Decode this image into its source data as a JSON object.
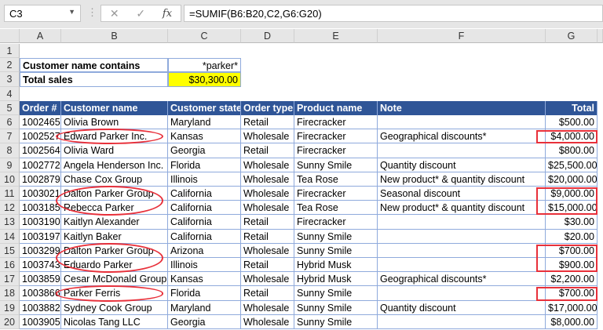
{
  "formula_bar": {
    "name_box": "C3",
    "formula": "=SUMIF(B6:B20,C2,G6:G20)",
    "cancel_icon": "✕",
    "enter_icon": "✓",
    "fx_icon": "fx"
  },
  "columns": [
    "A",
    "B",
    "C",
    "D",
    "E",
    "F",
    "G"
  ],
  "criteria": {
    "label": "Customer name contains",
    "value": "*parker*",
    "total_label": "Total sales",
    "total_value": "$30,300.00"
  },
  "table": {
    "headers": [
      "Order #",
      "Customer name",
      "Customer state",
      "Order type",
      "Product name",
      "Note",
      "Total"
    ],
    "rows": [
      [
        "1002465",
        "Olivia Brown",
        "Maryland",
        "Retail",
        "Firecracker",
        "",
        "$500.00"
      ],
      [
        "1002527",
        "Edward Parker Inc.",
        "Kansas",
        "Wholesale",
        "Firecracker",
        "Geographical discounts*",
        "$4,000.00"
      ],
      [
        "1002564",
        "Olivia Ward",
        "Georgia",
        "Retail",
        "Firecracker",
        "",
        "$800.00"
      ],
      [
        "1002772",
        "Angela Henderson Inc.",
        "Florida",
        "Wholesale",
        "Sunny Smile",
        "Quantity discount",
        "$25,500.00"
      ],
      [
        "1002879",
        "Chase Cox Group",
        "Illinois",
        "Wholesale",
        "Tea Rose",
        "New product* & quantity discount",
        "$20,000.00"
      ],
      [
        "1003021",
        "Dalton Parker Group",
        "California",
        "Wholesale",
        "Firecracker",
        "Seasonal discount",
        "$9,000.00"
      ],
      [
        "1003185",
        "Rebecca Parker",
        "California",
        "Wholesale",
        "Tea Rose",
        "New product* & quantity discount",
        "$15,000.00"
      ],
      [
        "1003190",
        "Kaitlyn Alexander",
        "California",
        "Retail",
        "Firecracker",
        "",
        "$30.00"
      ],
      [
        "1003197",
        "Kaitlyn Baker",
        "California",
        "Retail",
        "Sunny Smile",
        "",
        "$20.00"
      ],
      [
        "1003299",
        "Dalton Parker Group",
        "Arizona",
        "Wholesale",
        "Sunny Smile",
        "",
        "$700.00"
      ],
      [
        "1003743",
        "Eduardo Parker",
        "Illinois",
        "Retail",
        "Hybrid Musk",
        "",
        "$900.00"
      ],
      [
        "1003859",
        "Cesar McDonald Group",
        "Kansas",
        "Wholesale",
        "Hybrid Musk",
        "Geographical discounts*",
        "$2,200.00"
      ],
      [
        "1003866",
        "Parker Ferris",
        "Florida",
        "Retail",
        "Sunny Smile",
        "",
        "$700.00"
      ],
      [
        "1003882",
        "Sydney Cook Group",
        "Maryland",
        "Wholesale",
        "Sunny Smile",
        "Quantity discount",
        "$17,000.00"
      ],
      [
        "1003905",
        "Nicolas Tang LLC",
        "Georgia",
        "Wholesale",
        "Sunny Smile",
        "",
        "$8,000.00"
      ]
    ]
  },
  "highlight_color": "#e8303a"
}
